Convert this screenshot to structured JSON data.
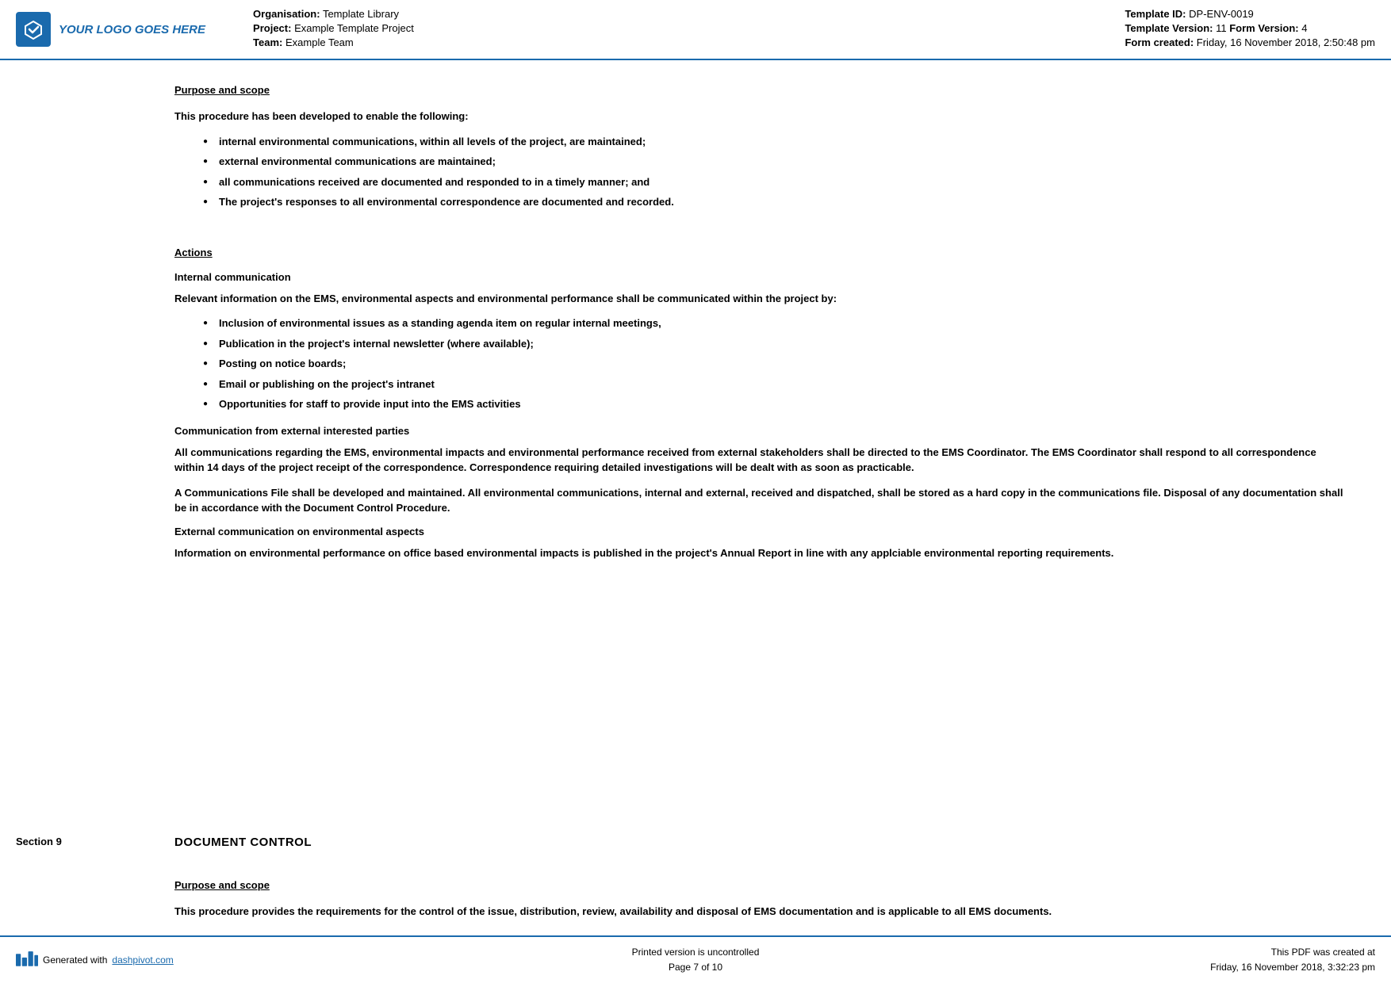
{
  "header": {
    "logo_text": "YOUR LOGO GOES HERE",
    "org_label": "Organisation:",
    "org_value": "Template Library",
    "project_label": "Project:",
    "project_value": "Example Template Project",
    "team_label": "Team:",
    "team_value": "Example Team",
    "template_id_label": "Template ID:",
    "template_id_value": "DP-ENV-0019",
    "template_version_label": "Template Version:",
    "template_version_value": "11",
    "form_version_label": "Form Version:",
    "form_version_value": "4",
    "form_created_label": "Form created:",
    "form_created_value": "Friday, 16 November 2018, 2:50:48 pm"
  },
  "section8": {
    "purpose_heading": "Purpose and scope",
    "intro_text": "This procedure has been developed to enable the following:",
    "bullets": [
      "internal environmental communications, within all levels of the project, are maintained;",
      "external environmental communications are maintained;",
      "all communications received are documented and responded to in a timely manner; and",
      "The project's responses to all environmental correspondence are documented and recorded."
    ],
    "actions_heading": "Actions",
    "internal_comm_title": "Internal communication",
    "internal_comm_intro": "Relevant information on the EMS, environmental aspects and environmental performance shall be communicated within the project by:",
    "internal_bullets": [
      "Inclusion of environmental issues as a standing agenda item on regular internal meetings,",
      "Publication in the project's internal newsletter (where available);",
      "Posting on notice boards;",
      "Email or publishing on the project's intranet",
      "Opportunities for staff to provide input into the EMS activities"
    ],
    "external_parties_title": "Communication from external interested parties",
    "external_parties_text": "All communications regarding the EMS, environmental impacts and environmental performance received from external stakeholders shall be directed to the EMS Coordinator. The EMS Coordinator shall respond to all correspondence within 14 days of the project receipt of the correspondence. Correspondence requiring detailed investigations will be dealt with as soon as practicable.",
    "comms_file_text": "A Communications File shall be developed and maintained. All environmental communications, internal and external, received and dispatched, shall be stored as a hard copy in the communications file. Disposal of any documentation shall be in accordance with the Document Control Procedure.",
    "external_env_title": "External communication on environmental aspects",
    "external_env_text": "Information on environmental performance on office based environmental impacts is published in the project's Annual Report in line with any applciable environmental reporting requirements."
  },
  "section9": {
    "label": "Section 9",
    "title": "DOCUMENT CONTROL",
    "purpose_heading": "Purpose and scope",
    "purpose_text": "This procedure provides the requirements for the control of the issue, distribution, review, availability and disposal of EMS documentation and is applicable to all EMS documents."
  },
  "footer": {
    "generated_label": "Generated with",
    "generated_link": "dashpivot.com",
    "center_line1": "Printed version is uncontrolled",
    "center_line2": "Page 7 of 10",
    "right_line1": "This PDF was created at",
    "right_line2": "Friday, 16 November 2018, 3:32:23 pm"
  }
}
